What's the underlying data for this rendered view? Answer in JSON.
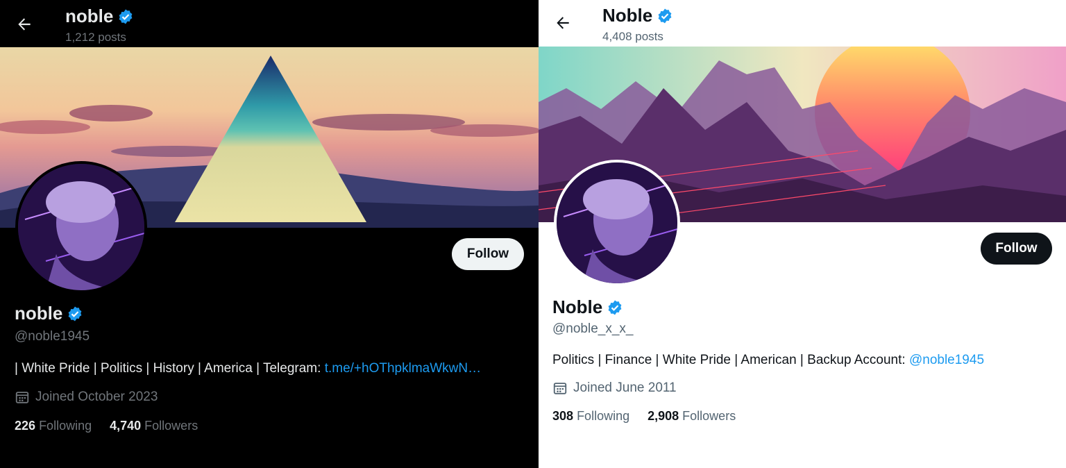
{
  "left": {
    "header_name": "noble",
    "header_posts": "1,212 posts",
    "display_name": "noble",
    "handle": "@noble1945",
    "bio_text": "| White Pride | Politics | History | America | Telegram: ",
    "bio_link": "t.me/+hOThpklmaWkwN…",
    "joined": "Joined October 2023",
    "following_count": "226",
    "following_label": "Following",
    "followers_count": "4,740",
    "followers_label": "Followers",
    "follow_label": "Follow"
  },
  "right": {
    "header_name": "Noble",
    "header_posts": "4,408 posts",
    "display_name": "Noble",
    "handle": "@noble_x_x_",
    "bio_text": "Politics | Finance | White Pride | American | Backup Account: ",
    "bio_link": "@noble1945",
    "joined": "Joined June 2011",
    "following_count": "308",
    "following_label": "Following",
    "followers_count": "2,908",
    "followers_label": "Followers",
    "follow_label": "Follow"
  },
  "colors": {
    "accent": "#1d9bf0",
    "dark_bg": "#000000",
    "light_bg": "#ffffff",
    "secondary_dark": "#71767b",
    "secondary_light": "#536471"
  },
  "icons": [
    "back-arrow-icon",
    "verified-badge-icon",
    "calendar-icon"
  ]
}
